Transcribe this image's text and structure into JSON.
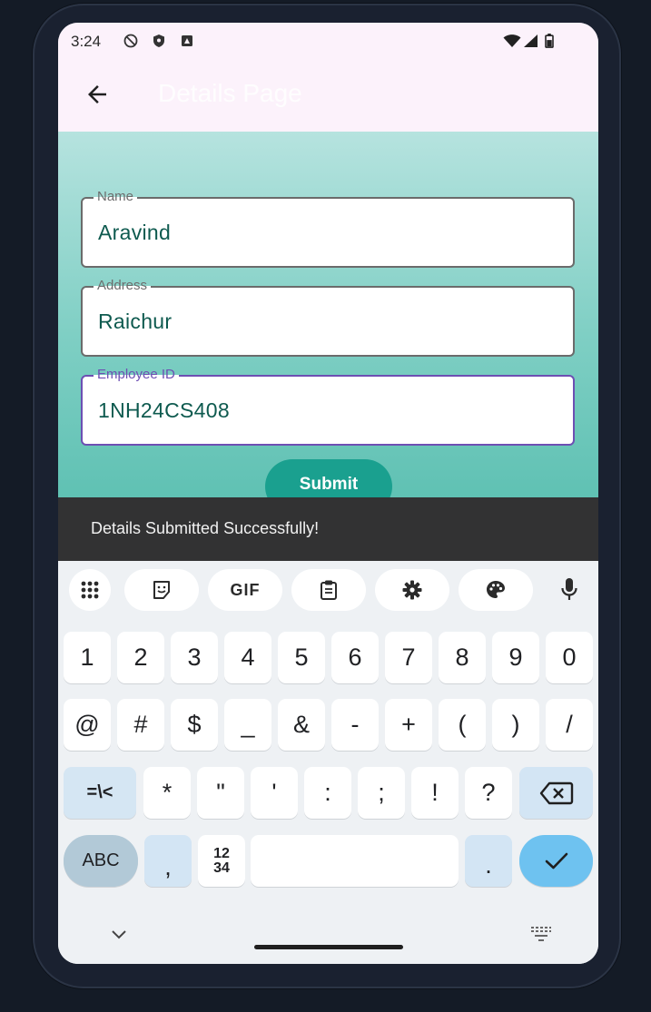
{
  "status_bar": {
    "time": "3:24",
    "icons": [
      "do-not-disturb-icon",
      "shield-icon",
      "notification-icon",
      "wifi-icon",
      "signal-icon",
      "battery-icon"
    ]
  },
  "app_bar": {
    "title": "Details Page",
    "back_icon": "arrow-back-icon"
  },
  "form": {
    "name": {
      "label": "Name",
      "value": "Aravind"
    },
    "address": {
      "label": "Address",
      "value": "Raichur"
    },
    "employee_id": {
      "label": "Employee ID",
      "value": "1NH24CS408"
    },
    "submit_label": "Submit"
  },
  "snackbar": {
    "message": "Details Submitted Successfully!"
  },
  "keyboard": {
    "toolbar": [
      "apps-grid-icon",
      "sticker-icon",
      "GIF",
      "clipboard-icon",
      "settings-icon",
      "palette-icon",
      "mic-icon"
    ],
    "gif_label": "GIF",
    "row1": [
      "1",
      "2",
      "3",
      "4",
      "5",
      "6",
      "7",
      "8",
      "9",
      "0"
    ],
    "row2": [
      "@",
      "#",
      "$",
      "_",
      "&",
      "-",
      "+",
      "(",
      ")",
      "/"
    ],
    "row3_mod": "=\\<",
    "row3": [
      "*",
      "\"",
      "'",
      ":",
      ";",
      "!",
      "?"
    ],
    "abc_label": "ABC",
    "comma": ",",
    "numpad_top": "12",
    "numpad_bottom": "34",
    "period": ".",
    "accent_color": "#6ec2f0"
  },
  "colors": {
    "content_top": "#b6e3df",
    "content_bottom": "#5fc1b3",
    "submit_button": "#1aa08f",
    "focused_border": "#6d4fb3",
    "snackbar_bg": "#323233"
  }
}
